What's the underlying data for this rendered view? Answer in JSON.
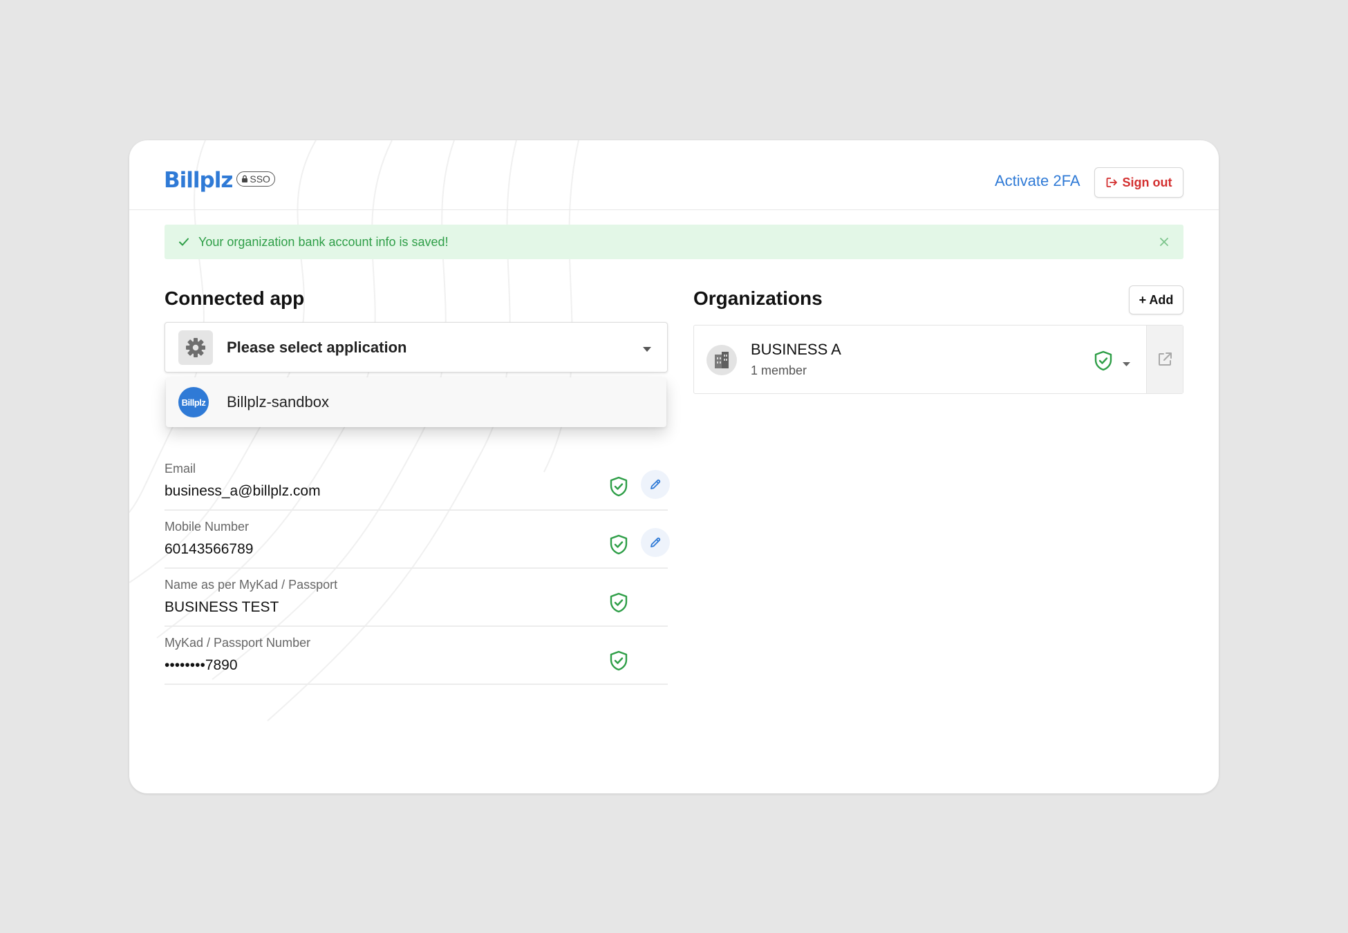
{
  "header": {
    "logo_text": "Billplz",
    "logo_badge": "SSO",
    "activate_2fa": "Activate 2FA",
    "sign_out": "Sign out"
  },
  "alert": {
    "message": "Your organization bank account info is saved!"
  },
  "connected_app": {
    "title": "Connected app",
    "select_placeholder": "Please select application",
    "options": [
      {
        "avatar_text": "Billplz",
        "name": "Billplz-sandbox"
      }
    ]
  },
  "fields": [
    {
      "label": "Email",
      "value": "business_a@billplz.com",
      "verified": true,
      "editable": true
    },
    {
      "label": "Mobile Number",
      "value": "60143566789",
      "verified": true,
      "editable": true
    },
    {
      "label": "Name as per MyKad / Passport",
      "value": "BUSINESS TEST",
      "verified": true,
      "editable": false
    },
    {
      "label": "MyKad / Passport Number",
      "value": "••••••••7890",
      "verified": true,
      "editable": false
    }
  ],
  "organizations": {
    "title": "Organizations",
    "add_label": "+ Add",
    "items": [
      {
        "name": "BUSINESS A",
        "members": "1 member",
        "verified": true
      }
    ]
  },
  "colors": {
    "background": "#e6e6e6",
    "brand_blue": "#2f7ad6",
    "success_green": "#2e9e47",
    "alert_bg": "#e3f7e7",
    "danger_red": "#d32f2f"
  },
  "icons": {
    "lock": "lock-icon",
    "sign_out": "sign-out-icon",
    "check": "check-icon",
    "close": "close-icon",
    "gear": "gear-icon",
    "caret": "caret-down-icon",
    "shield": "shield-check-icon",
    "edit": "pencil-icon",
    "building": "building-icon",
    "external_link": "external-link-icon"
  }
}
